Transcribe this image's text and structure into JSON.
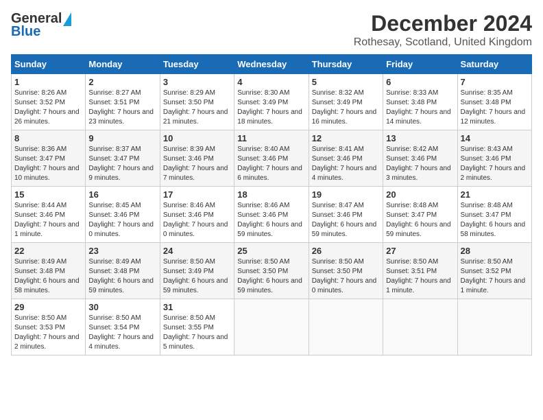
{
  "logo": {
    "line1": "General",
    "line2": "Blue"
  },
  "title": "December 2024",
  "subtitle": "Rothesay, Scotland, United Kingdom",
  "days_header": [
    "Sunday",
    "Monday",
    "Tuesday",
    "Wednesday",
    "Thursday",
    "Friday",
    "Saturday"
  ],
  "weeks": [
    [
      {
        "day": "1",
        "sunrise": "8:26 AM",
        "sunset": "3:52 PM",
        "daylight": "7 hours and 26 minutes."
      },
      {
        "day": "2",
        "sunrise": "8:27 AM",
        "sunset": "3:51 PM",
        "daylight": "7 hours and 23 minutes."
      },
      {
        "day": "3",
        "sunrise": "8:29 AM",
        "sunset": "3:50 PM",
        "daylight": "7 hours and 21 minutes."
      },
      {
        "day": "4",
        "sunrise": "8:30 AM",
        "sunset": "3:49 PM",
        "daylight": "7 hours and 18 minutes."
      },
      {
        "day": "5",
        "sunrise": "8:32 AM",
        "sunset": "3:49 PM",
        "daylight": "7 hours and 16 minutes."
      },
      {
        "day": "6",
        "sunrise": "8:33 AM",
        "sunset": "3:48 PM",
        "daylight": "7 hours and 14 minutes."
      },
      {
        "day": "7",
        "sunrise": "8:35 AM",
        "sunset": "3:48 PM",
        "daylight": "7 hours and 12 minutes."
      }
    ],
    [
      {
        "day": "8",
        "sunrise": "8:36 AM",
        "sunset": "3:47 PM",
        "daylight": "7 hours and 10 minutes."
      },
      {
        "day": "9",
        "sunrise": "8:37 AM",
        "sunset": "3:47 PM",
        "daylight": "7 hours and 9 minutes."
      },
      {
        "day": "10",
        "sunrise": "8:39 AM",
        "sunset": "3:46 PM",
        "daylight": "7 hours and 7 minutes."
      },
      {
        "day": "11",
        "sunrise": "8:40 AM",
        "sunset": "3:46 PM",
        "daylight": "7 hours and 6 minutes."
      },
      {
        "day": "12",
        "sunrise": "8:41 AM",
        "sunset": "3:46 PM",
        "daylight": "7 hours and 4 minutes."
      },
      {
        "day": "13",
        "sunrise": "8:42 AM",
        "sunset": "3:46 PM",
        "daylight": "7 hours and 3 minutes."
      },
      {
        "day": "14",
        "sunrise": "8:43 AM",
        "sunset": "3:46 PM",
        "daylight": "7 hours and 2 minutes."
      }
    ],
    [
      {
        "day": "15",
        "sunrise": "8:44 AM",
        "sunset": "3:46 PM",
        "daylight": "7 hours and 1 minute."
      },
      {
        "day": "16",
        "sunrise": "8:45 AM",
        "sunset": "3:46 PM",
        "daylight": "7 hours and 0 minutes."
      },
      {
        "day": "17",
        "sunrise": "8:46 AM",
        "sunset": "3:46 PM",
        "daylight": "7 hours and 0 minutes."
      },
      {
        "day": "18",
        "sunrise": "8:46 AM",
        "sunset": "3:46 PM",
        "daylight": "6 hours and 59 minutes."
      },
      {
        "day": "19",
        "sunrise": "8:47 AM",
        "sunset": "3:46 PM",
        "daylight": "6 hours and 59 minutes."
      },
      {
        "day": "20",
        "sunrise": "8:48 AM",
        "sunset": "3:47 PM",
        "daylight": "6 hours and 59 minutes."
      },
      {
        "day": "21",
        "sunrise": "8:48 AM",
        "sunset": "3:47 PM",
        "daylight": "6 hours and 58 minutes."
      }
    ],
    [
      {
        "day": "22",
        "sunrise": "8:49 AM",
        "sunset": "3:48 PM",
        "daylight": "6 hours and 58 minutes."
      },
      {
        "day": "23",
        "sunrise": "8:49 AM",
        "sunset": "3:48 PM",
        "daylight": "6 hours and 59 minutes."
      },
      {
        "day": "24",
        "sunrise": "8:50 AM",
        "sunset": "3:49 PM",
        "daylight": "6 hours and 59 minutes."
      },
      {
        "day": "25",
        "sunrise": "8:50 AM",
        "sunset": "3:50 PM",
        "daylight": "6 hours and 59 minutes."
      },
      {
        "day": "26",
        "sunrise": "8:50 AM",
        "sunset": "3:50 PM",
        "daylight": "7 hours and 0 minutes."
      },
      {
        "day": "27",
        "sunrise": "8:50 AM",
        "sunset": "3:51 PM",
        "daylight": "7 hours and 1 minute."
      },
      {
        "day": "28",
        "sunrise": "8:50 AM",
        "sunset": "3:52 PM",
        "daylight": "7 hours and 1 minute."
      }
    ],
    [
      {
        "day": "29",
        "sunrise": "8:50 AM",
        "sunset": "3:53 PM",
        "daylight": "7 hours and 2 minutes."
      },
      {
        "day": "30",
        "sunrise": "8:50 AM",
        "sunset": "3:54 PM",
        "daylight": "7 hours and 4 minutes."
      },
      {
        "day": "31",
        "sunrise": "8:50 AM",
        "sunset": "3:55 PM",
        "daylight": "7 hours and 5 minutes."
      },
      null,
      null,
      null,
      null
    ]
  ]
}
